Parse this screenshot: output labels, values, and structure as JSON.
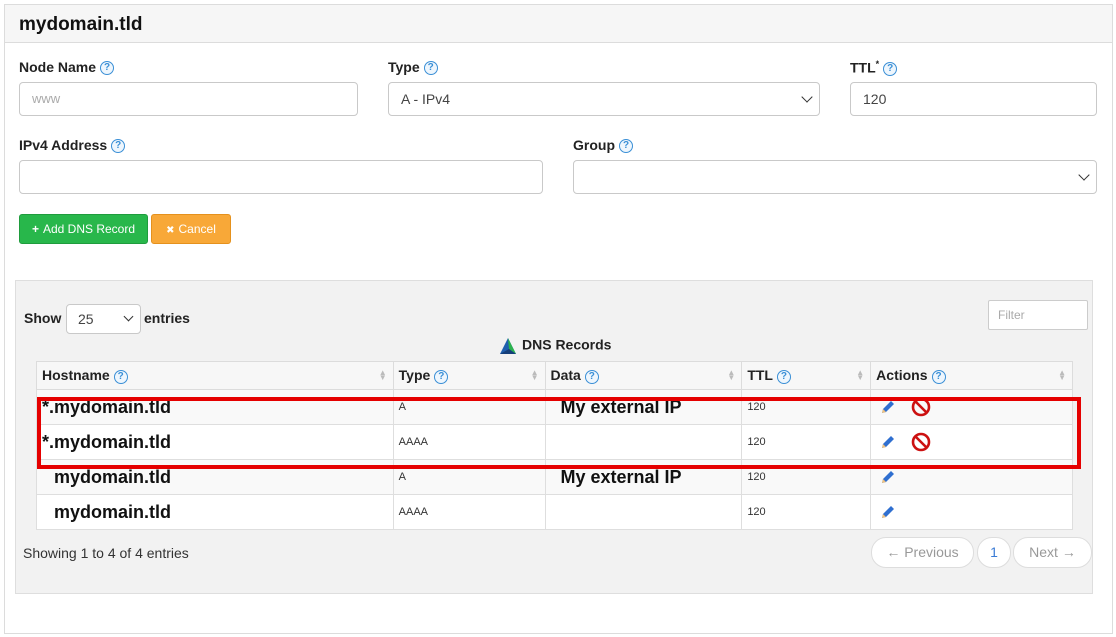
{
  "header": {
    "title": "mydomain.tld"
  },
  "form": {
    "node_name_label": "Node Name",
    "node_name_placeholder": "www",
    "type_label": "Type",
    "type_value": "A - IPv4",
    "ttl_label": "TTL",
    "ttl_required_mark": "*",
    "ttl_value": "120",
    "ipv4_label": "IPv4 Address",
    "ipv4_value": "",
    "group_label": "Group",
    "group_value": "",
    "help_glyph": "?"
  },
  "buttons": {
    "add_label": "Add DNS Record",
    "add_glyph": "+",
    "cancel_label": "Cancel",
    "cancel_glyph": "✖"
  },
  "records": {
    "show_label": "Show",
    "entries_label": "entries",
    "page_size": "25",
    "filter_placeholder": "Filter",
    "table_title": "DNS Records",
    "columns": [
      "Hostname",
      "Type",
      "Data",
      "TTL",
      "Actions"
    ],
    "rows": [
      {
        "hostname": "*.mydomain.tld",
        "type": "A",
        "data": "My external IP",
        "ttl": "120",
        "deletable": true
      },
      {
        "hostname": "*.mydomain.tld",
        "type": "AAAA",
        "data": "",
        "ttl": "120",
        "deletable": true
      },
      {
        "hostname": "mydomain.tld",
        "type": "A",
        "data": "My external IP",
        "ttl": "120",
        "deletable": false
      },
      {
        "hostname": "mydomain.tld",
        "type": "AAAA",
        "data": "",
        "ttl": "120",
        "deletable": false
      }
    ],
    "info": "Showing 1 to 4 of 4 entries",
    "pager": {
      "previous": "← Previous",
      "current": "1",
      "next": "Next →"
    }
  },
  "colors": {
    "add_button": "#28b74b",
    "cancel_button": "#f8a838",
    "highlight_box": "#e50000",
    "help_icon": "#3a8fd6",
    "edit_icon": "#2f6fd0",
    "delete_icon": "#cc1111"
  }
}
